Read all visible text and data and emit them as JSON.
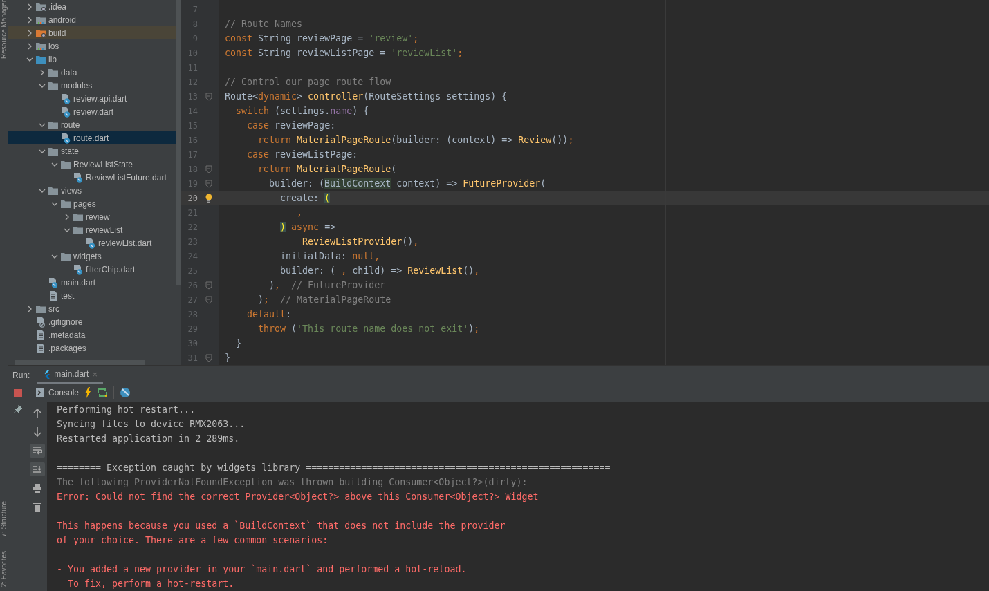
{
  "side_stripe": {
    "labels": [
      "Resource Manager",
      "7: Structure",
      "2: Favorites"
    ]
  },
  "project_tree": {
    "items": [
      {
        "name": ".idea",
        "kind": "folder-config",
        "expanded": false,
        "selected": false
      },
      {
        "name": "android",
        "kind": "folder-module",
        "expanded": false,
        "selected": false
      },
      {
        "name": "build",
        "kind": "folder-excluded",
        "expanded": false,
        "selected": false
      },
      {
        "name": "ios",
        "kind": "folder-module",
        "expanded": false,
        "selected": false
      },
      {
        "name": "lib",
        "kind": "folder-source",
        "expanded": true,
        "selected": false,
        "children": [
          {
            "name": "data",
            "kind": "folder",
            "expanded": false,
            "selected": false
          },
          {
            "name": "modules",
            "kind": "folder",
            "expanded": true,
            "selected": false,
            "children": [
              {
                "name": "review.api.dart",
                "kind": "dart-file",
                "selected": false
              },
              {
                "name": "review.dart",
                "kind": "dart-file",
                "selected": false
              }
            ]
          },
          {
            "name": "route",
            "kind": "folder",
            "expanded": true,
            "selected": false,
            "children": [
              {
                "name": "route.dart",
                "kind": "dart-file",
                "selected": true
              }
            ]
          },
          {
            "name": "state",
            "kind": "folder",
            "expanded": true,
            "selected": false,
            "children": [
              {
                "name": "ReviewListState",
                "kind": "folder",
                "expanded": true,
                "selected": false,
                "children": [
                  {
                    "name": "ReviewListFuture.dart",
                    "kind": "dart-file",
                    "selected": false
                  }
                ]
              }
            ]
          },
          {
            "name": "views",
            "kind": "folder",
            "expanded": true,
            "selected": false,
            "children": [
              {
                "name": "pages",
                "kind": "folder",
                "expanded": true,
                "selected": false,
                "children": [
                  {
                    "name": "review",
                    "kind": "folder",
                    "expanded": false,
                    "selected": false
                  },
                  {
                    "name": "reviewList",
                    "kind": "folder",
                    "expanded": true,
                    "selected": false,
                    "children": [
                      {
                        "name": "reviewList.dart",
                        "kind": "dart-file",
                        "selected": false
                      }
                    ]
                  }
                ]
              },
              {
                "name": "widgets",
                "kind": "folder",
                "expanded": true,
                "selected": false,
                "children": [
                  {
                    "name": "filterChip.dart",
                    "kind": "dart-file",
                    "selected": false
                  }
                ]
              }
            ]
          },
          {
            "name": "main.dart",
            "kind": "dart-file",
            "selected": false
          },
          {
            "name": "test",
            "kind": "text-file",
            "selected": false
          }
        ]
      },
      {
        "name": "src",
        "kind": "folder",
        "expanded": false,
        "selected": false
      },
      {
        "name": ".gitignore",
        "kind": "ignore-file",
        "selected": false
      },
      {
        "name": ".metadata",
        "kind": "text-file",
        "selected": false
      },
      {
        "name": ".packages",
        "kind": "text-file",
        "selected": false
      }
    ]
  },
  "editor": {
    "lines": [
      {
        "number": "7",
        "current": false,
        "fold": false,
        "bulb": false
      },
      {
        "number": "8",
        "current": false,
        "fold": false,
        "bulb": false,
        "tokens": [
          {
            "text": "// Route Names",
            "kind": "comment"
          }
        ]
      },
      {
        "number": "9",
        "current": false,
        "fold": false,
        "bulb": false,
        "tokens": [
          {
            "text": "const ",
            "kind": "keyword"
          },
          {
            "text": "String reviewPage = ",
            "kind": "plain"
          },
          {
            "text": "'review'",
            "kind": "string"
          },
          {
            "text": ";",
            "kind": "keyword"
          }
        ]
      },
      {
        "number": "10",
        "current": false,
        "fold": false,
        "bulb": false,
        "tokens": [
          {
            "text": "const ",
            "kind": "keyword"
          },
          {
            "text": "String reviewListPage = ",
            "kind": "plain"
          },
          {
            "text": "'reviewList'",
            "kind": "string"
          },
          {
            "text": ";",
            "kind": "keyword"
          }
        ]
      },
      {
        "number": "11",
        "current": false,
        "fold": false,
        "bulb": false
      },
      {
        "number": "12",
        "current": false,
        "fold": false,
        "bulb": false,
        "tokens": [
          {
            "text": "// Control our page route flow",
            "kind": "comment"
          }
        ]
      },
      {
        "number": "13",
        "current": false,
        "fold": true,
        "bulb": false,
        "tokens": [
          {
            "text": "Route<",
            "kind": "plain"
          },
          {
            "text": "dynamic",
            "kind": "keyword"
          },
          {
            "text": "> ",
            "kind": "plain"
          },
          {
            "text": "controller",
            "kind": "function"
          },
          {
            "text": "(RouteSettings settings) {",
            "kind": "plain"
          }
        ]
      },
      {
        "number": "14",
        "current": false,
        "fold": false,
        "bulb": false,
        "tokens": [
          {
            "text": "  switch",
            "kind": "keyword"
          },
          {
            "text": " (settings.",
            "kind": "plain"
          },
          {
            "text": "name",
            "kind": "field"
          },
          {
            "text": ") {",
            "kind": "plain"
          }
        ]
      },
      {
        "number": "15",
        "current": false,
        "fold": false,
        "bulb": false,
        "tokens": [
          {
            "text": "    case",
            "kind": "keyword"
          },
          {
            "text": " reviewPage:",
            "kind": "plain"
          }
        ]
      },
      {
        "number": "16",
        "current": false,
        "fold": false,
        "bulb": false,
        "tokens": [
          {
            "text": "      return ",
            "kind": "keyword"
          },
          {
            "text": "MaterialPageRoute",
            "kind": "function"
          },
          {
            "text": "(builder: (context) => ",
            "kind": "plain"
          },
          {
            "text": "Review",
            "kind": "function"
          },
          {
            "text": "())",
            "kind": "plain"
          },
          {
            "text": ";",
            "kind": "keyword"
          }
        ]
      },
      {
        "number": "17",
        "current": false,
        "fold": false,
        "bulb": false,
        "tokens": [
          {
            "text": "    case",
            "kind": "keyword"
          },
          {
            "text": " reviewListPage:",
            "kind": "plain"
          }
        ]
      },
      {
        "number": "18",
        "current": false,
        "fold": true,
        "bulb": false,
        "tokens": [
          {
            "text": "      return ",
            "kind": "keyword"
          },
          {
            "text": "MaterialPageRoute",
            "kind": "function"
          },
          {
            "text": "(",
            "kind": "plain"
          }
        ]
      },
      {
        "number": "19",
        "current": false,
        "fold": true,
        "bulb": false,
        "tokens": [
          {
            "text": "        builder: (",
            "kind": "plain"
          },
          {
            "text": "BuildContext",
            "kind": "match"
          },
          {
            "text": " context) => ",
            "kind": "plain"
          },
          {
            "text": "FutureProvider",
            "kind": "function"
          },
          {
            "text": "(",
            "kind": "plain"
          }
        ]
      },
      {
        "number": "20",
        "current": true,
        "fold": false,
        "bulb": true,
        "tokens": [
          {
            "text": "          create: ",
            "kind": "plain"
          },
          {
            "text": "(",
            "kind": "brace"
          }
        ]
      },
      {
        "number": "21",
        "current": false,
        "fold": false,
        "bulb": false,
        "tokens": [
          {
            "text": "            _",
            "kind": "plain"
          },
          {
            "text": ",",
            "kind": "keyword"
          }
        ]
      },
      {
        "number": "22",
        "current": false,
        "fold": false,
        "bulb": false,
        "tokens": [
          {
            "text": "          )",
            "kind": "brace"
          },
          {
            "text": " async ",
            "kind": "keyword"
          },
          {
            "text": "=>",
            "kind": "plain"
          }
        ]
      },
      {
        "number": "23",
        "current": false,
        "fold": false,
        "bulb": false,
        "tokens": [
          {
            "text": "              ReviewListProvider",
            "kind": "function"
          },
          {
            "text": "()",
            "kind": "plain"
          },
          {
            "text": ",",
            "kind": "keyword"
          }
        ]
      },
      {
        "number": "24",
        "current": false,
        "fold": false,
        "bulb": false,
        "tokens": [
          {
            "text": "          initialData: ",
            "kind": "plain"
          },
          {
            "text": "null,",
            "kind": "keyword"
          }
        ]
      },
      {
        "number": "25",
        "current": false,
        "fold": false,
        "bulb": false,
        "tokens": [
          {
            "text": "          builder: (_",
            "kind": "plain"
          },
          {
            "text": ",",
            "kind": "keyword"
          },
          {
            "text": " child) => ",
            "kind": "plain"
          },
          {
            "text": "ReviewList",
            "kind": "function"
          },
          {
            "text": "()",
            "kind": "plain"
          },
          {
            "text": ",",
            "kind": "keyword"
          }
        ]
      },
      {
        "number": "26",
        "current": false,
        "fold": true,
        "bulb": false,
        "tokens": [
          {
            "text": "        )",
            "kind": "plain"
          },
          {
            "text": ",",
            "kind": "keyword"
          },
          {
            "text": "  // FutureProvider",
            "kind": "comment"
          }
        ]
      },
      {
        "number": "27",
        "current": false,
        "fold": true,
        "bulb": false,
        "tokens": [
          {
            "text": "      )",
            "kind": "plain"
          },
          {
            "text": ";",
            "kind": "keyword"
          },
          {
            "text": "  // MaterialPageRoute",
            "kind": "comment"
          }
        ]
      },
      {
        "number": "28",
        "current": false,
        "fold": false,
        "bulb": false,
        "tokens": [
          {
            "text": "    default",
            "kind": "keyword"
          },
          {
            "text": ":",
            "kind": "plain"
          }
        ]
      },
      {
        "number": "29",
        "current": false,
        "fold": false,
        "bulb": false,
        "tokens": [
          {
            "text": "      throw ",
            "kind": "keyword"
          },
          {
            "text": "(",
            "kind": "plain"
          },
          {
            "text": "'This route name does not exit'",
            "kind": "string"
          },
          {
            "text": ")",
            "kind": "plain"
          },
          {
            "text": ";",
            "kind": "keyword"
          }
        ]
      },
      {
        "number": "30",
        "current": false,
        "fold": false,
        "bulb": false,
        "tokens": [
          {
            "text": "  }",
            "kind": "plain"
          }
        ]
      },
      {
        "number": "31",
        "current": false,
        "fold": true,
        "bulb": false,
        "tokens": [
          {
            "text": "}",
            "kind": "plain"
          }
        ]
      }
    ]
  },
  "run_panel": {
    "label": "Run:",
    "tabs": [
      {
        "label": "main.dart",
        "selected": true,
        "close": "×"
      }
    ],
    "toolbar": {
      "console_tab": "Console"
    },
    "console": [
      {
        "kind": "normal",
        "text": "Performing hot restart..."
      },
      {
        "kind": "normal",
        "text": "Syncing files to device RMX2063..."
      },
      {
        "kind": "normal",
        "text": "Restarted application in 2 289ms."
      },
      {
        "kind": "blank"
      },
      {
        "kind": "normal",
        "text": "======== Exception caught by widgets library ======================================================="
      },
      {
        "kind": "muted",
        "text": "The following ProviderNotFoundException was thrown building Consumer<Object?>(dirty):"
      },
      {
        "kind": "error",
        "text": "Error: Could not find the correct Provider<Object?> above this Consumer<Object?> Widget"
      },
      {
        "kind": "blank"
      },
      {
        "kind": "error",
        "text": "This happens because you used a `BuildContext` that does not include the provider"
      },
      {
        "kind": "error",
        "text": "of your choice. There are a few common scenarios:"
      },
      {
        "kind": "blank"
      },
      {
        "kind": "error",
        "text": "- You added a new provider in your `main.dart` and performed a hot-reload."
      },
      {
        "kind": "error",
        "text": "  To fix, perform a hot-restart."
      }
    ]
  }
}
